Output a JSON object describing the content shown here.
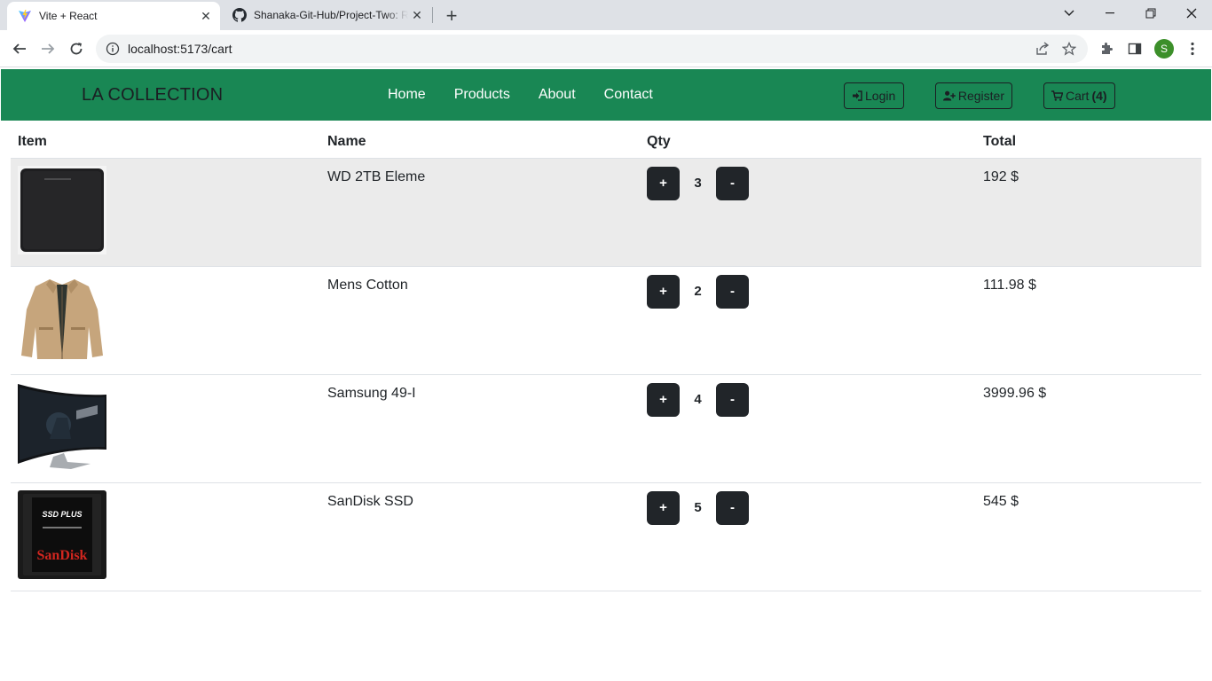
{
  "browser": {
    "tabs": [
      {
        "title": "Vite + React",
        "active": true,
        "icon": "vite-icon"
      },
      {
        "title": "Shanaka-Git-Hub/Project-Two: R",
        "active": false,
        "icon": "github-icon"
      }
    ],
    "url": "localhost:5173/cart",
    "profile_initial": "S"
  },
  "navbar": {
    "brand": "LA COLLECTION",
    "links": [
      "Home",
      "Products",
      "About",
      "Contact"
    ],
    "login_label": "Login",
    "register_label": "Register",
    "cart_label": "Cart",
    "cart_count": "(4)",
    "color": "#198754"
  },
  "cart": {
    "headers": {
      "item": "Item",
      "name": "Name",
      "qty": "Qty",
      "total": "Total"
    },
    "plus_label": "+",
    "minus_label": "-",
    "rows": [
      {
        "name": "WD 2TB Eleme",
        "qty": "3",
        "total": "192 $",
        "image": "external-hard-drive"
      },
      {
        "name": "Mens Cotton",
        "qty": "2",
        "total": "111.98 $",
        "image": "khaki-jacket"
      },
      {
        "name": "Samsung 49-I",
        "qty": "4",
        "total": "3999.96 $",
        "image": "curved-monitor"
      },
      {
        "name": "SanDisk SSD",
        "qty": "5",
        "total": "545 $",
        "image": "sandisk-ssd"
      }
    ]
  },
  "product_image_text": {
    "ssd_line1": "SSD PLUS",
    "ssd_brand": "SanDisk"
  }
}
